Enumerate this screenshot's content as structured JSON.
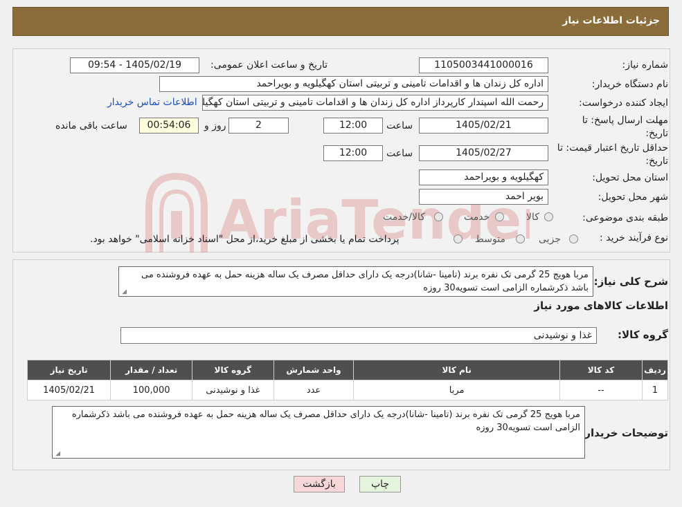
{
  "header": {
    "title": "جزئیات اطلاعات نیاز"
  },
  "watermark": {
    "text": "AriaTender.neT"
  },
  "form": {
    "need_number_label": "شماره نیاز:",
    "need_number": "1105003441000016",
    "announce_label": "تاریخ و ساعت اعلان عمومی:",
    "announce_value": "1405/02/19 - 09:54",
    "buyer_org_label": "نام دستگاه خریدار:",
    "buyer_org": "اداره کل زندان ها و اقدامات تامینی و تربیتی استان کهگیلویه و بویراحمد",
    "creator_label": "ایجاد کننده درخواست:",
    "creator": "رحمت الله اسپندار کارپرداز اداره کل زندان ها و اقدامات تامینی و تربیتی استان کهگیلویه و بویراحمد",
    "contact_link": "اطلاعات تماس خریدار",
    "deadline_label_1": "مهلت ارسال پاسخ: تا",
    "deadline_label_2": "تاریخ:",
    "deadline_date": "1405/02/21",
    "time_label": "ساعت",
    "deadline_time": "12:00",
    "days_value": "2",
    "days_label": "روز و",
    "remaining_time": "00:54:06",
    "remaining_label": "ساعت باقی مانده",
    "validity_label_1": "حداقل تاریخ اعتبار قیمت: تا",
    "validity_label_2": "تاریخ:",
    "validity_date": "1405/02/27",
    "validity_time_label": "ساعت",
    "validity_time": "12:00",
    "province_label": "استان محل تحویل:",
    "province": "کهگیلویه و بویراحمد",
    "city_label": "شهر محل تحویل:",
    "city": "بویر احمد",
    "category_label": "طبقه بندی موضوعی:",
    "category_options": [
      "کالا",
      "خدمت",
      "کالا/خدمت"
    ],
    "process_label": "نوع فرآیند خرید :",
    "process_options": [
      "جزیی",
      "متوسط"
    ],
    "process_note": "پرداخت تمام یا بخشی از مبلغ خرید،از محل \"اسناد خزانه اسلامی\" خواهد بود."
  },
  "details": {
    "summary_label": "شرح کلی نیاز:",
    "summary": "مربا هویج 25 گرمی تک نفره برند (تامینا -شانا)درجه یک دارای حداقل مصرف یک ساله هزینه حمل به عهده فروشنده می باشد ذکرشماره الزامی است تسویه30 روزه",
    "goods_info_title": "اطلاعات کالاهای مورد نیاز",
    "goods_group_label": "گروه کالا:",
    "goods_group": "غذا و نوشیدنی",
    "table": {
      "headers": [
        "ردیف",
        "کد کالا",
        "نام کالا",
        "واحد شمارش",
        "گروه کالا",
        "تعداد / مقدار",
        "تاریخ نیاز"
      ],
      "rows": [
        [
          "1",
          "--",
          "مربا",
          "عدد",
          "غذا و نوشیدنی",
          "100,000",
          "1405/02/21"
        ]
      ]
    },
    "buyer_notes_label": "توضیحات خریدار:",
    "buyer_notes": "مربا هویج 25 گرمی تک نفره برند (تامینا -شانا)درجه یک دارای حداقل مصرف یک ساله هزینه حمل به عهده فروشنده می باشد ذکرشماره الزامی است تسویه30 روزه"
  },
  "buttons": {
    "print": "چاپ",
    "back": "بازگشت"
  },
  "colors": {
    "header_bg": "#8a6d3b",
    "table_header": "#4f4f4f",
    "print_btn": "#e4f5de",
    "back_btn": "#f8d7d7",
    "link": "#1a4fbf"
  }
}
